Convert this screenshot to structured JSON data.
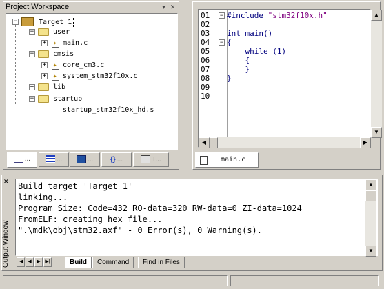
{
  "workspace": {
    "title": "Project Workspace",
    "pin_glyph": "▾",
    "close_glyph": "✕",
    "tree": [
      {
        "label": "Target 1",
        "expander": "−",
        "icon": "target-icon",
        "selected": true
      },
      {
        "label": "user",
        "expander": "−",
        "icon": "folder-icon"
      },
      {
        "label": "main.c",
        "expander": "+",
        "icon": "file-icon"
      },
      {
        "label": "cmsis",
        "expander": "−",
        "icon": "folder-icon"
      },
      {
        "label": "core_cm3.c",
        "expander": "+",
        "icon": "file-icon"
      },
      {
        "label": "system_stm32f10x.c",
        "expander": "+",
        "icon": "file-icon"
      },
      {
        "label": "lib",
        "expander": "+",
        "icon": "folder-icon"
      },
      {
        "label": "startup",
        "expander": "−",
        "icon": "folder-icon"
      },
      {
        "label": "startup_stm32f10x_hd.s",
        "expander": "",
        "icon": "file-icon"
      }
    ],
    "tabs": [
      {
        "label": "...",
        "icon": "files-icon",
        "active": true
      },
      {
        "label": "...",
        "icon": "registers-icon"
      },
      {
        "label": "...",
        "icon": "books-icon"
      },
      {
        "label": "...",
        "icon": "functions-icon",
        "glyph": "{}"
      },
      {
        "label": "T...",
        "icon": "templates-icon"
      }
    ]
  },
  "editor": {
    "line_numbers": [
      "01",
      "02",
      "03",
      "04",
      "05",
      "06",
      "07",
      "08",
      "09",
      "10"
    ],
    "lines": [
      {
        "text": "#include ",
        "string": "\"stm32f10x.h\"",
        "fold": "−"
      },
      {
        "text": ""
      },
      {
        "text": "int main()"
      },
      {
        "text": "{",
        "fold": "−"
      },
      {
        "text": "    while (1)"
      },
      {
        "text": "    {"
      },
      {
        "text": "    }"
      },
      {
        "text": "}"
      },
      {
        "text": ""
      },
      {
        "text": ""
      }
    ],
    "tab_label": "main.c",
    "arrows": {
      "up": "▲",
      "down": "▼",
      "left": "◀",
      "right": "▶"
    }
  },
  "output": {
    "title": "Output Window",
    "lines": [
      "Build target 'Target 1'",
      "linking...",
      "Program Size: Code=432 RO-data=320 RW-data=0 ZI-data=1024",
      "FromELF: creating hex file...",
      "\".\\mdk\\obj\\stm32.axf\" - 0 Error(s), 0 Warning(s)."
    ],
    "tabs": [
      {
        "label": "Build",
        "active": true
      },
      {
        "label": "Command"
      },
      {
        "label": "Find in Files"
      }
    ],
    "nav": [
      "|◀",
      "◀",
      "▶",
      "▶|"
    ],
    "close_glyph": "✕"
  }
}
